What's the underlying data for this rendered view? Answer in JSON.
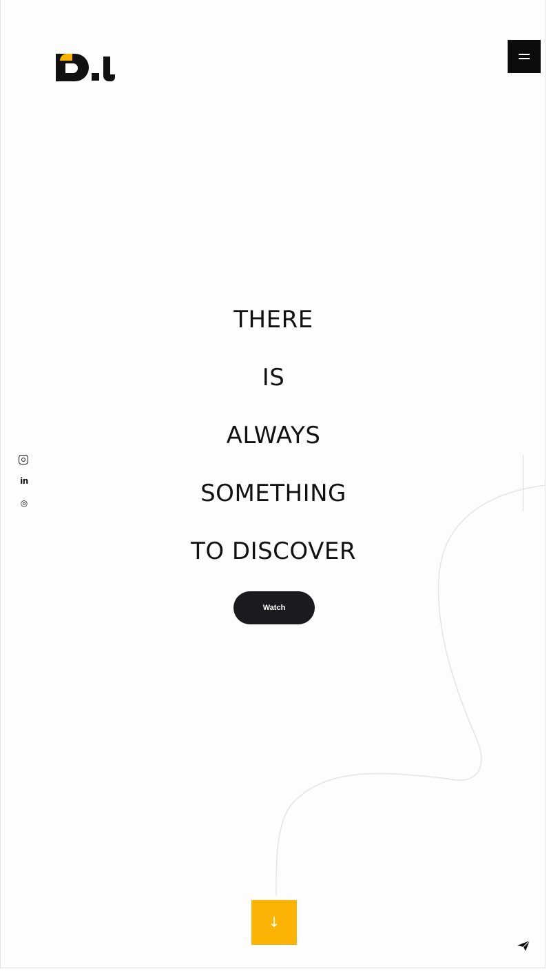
{
  "header": {
    "logo_text": "D.L",
    "menu_icon": "hamburger-icon"
  },
  "social": [
    {
      "icon": "instagram-icon"
    },
    {
      "icon": "linkedin-icon",
      "glyph": "in"
    },
    {
      "icon": "dribbble-icon",
      "glyph": "◎"
    }
  ],
  "hero": {
    "lines": [
      "THERE",
      "IS",
      "ALWAYS",
      "SOMETHING",
      "TO DISCOVER"
    ],
    "watch_label": "Watch"
  },
  "scroll": {
    "arrow": "↓"
  },
  "colors": {
    "accent": "#fbb306",
    "dark": "#0c0c0c",
    "button": "#1b1b1f"
  }
}
